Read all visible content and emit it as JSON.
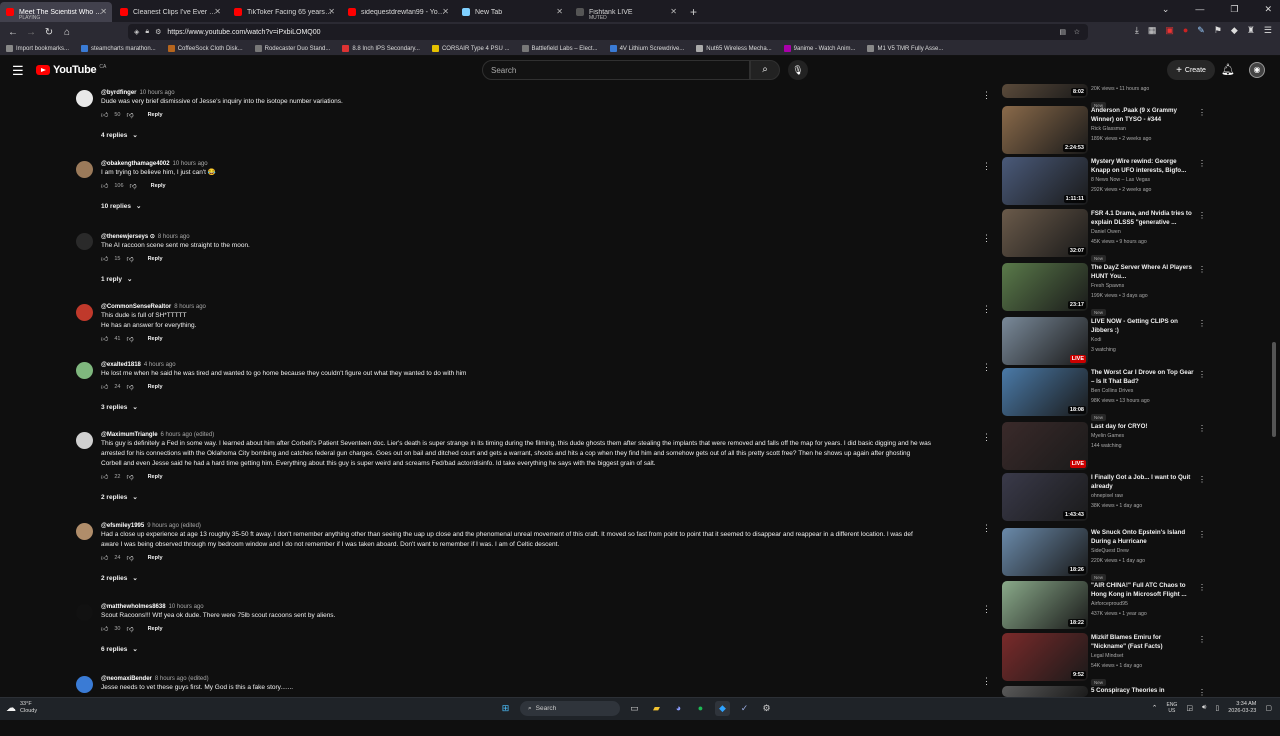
{
  "browser": {
    "tabs": [
      {
        "title": "Meet The Scientist Who Studie",
        "sub": "PLAYING",
        "active": true,
        "color": "#ff0000"
      },
      {
        "title": "Cleanest Clips I've Ever Hit - (I",
        "sub": "",
        "active": false,
        "color": "#ff0000"
      },
      {
        "title": "TikToker Facing 65 years in Pri",
        "sub": "",
        "active": false,
        "color": "#ff0000"
      },
      {
        "title": "sidequestdrewfan99 - YouTube",
        "sub": "",
        "active": false,
        "color": "#ff0000"
      },
      {
        "title": "New Tab",
        "sub": "",
        "active": false,
        "color": "#7fd0ff"
      },
      {
        "title": "Fishtank LIVE",
        "sub": "MUTED",
        "active": false,
        "color": "#555555"
      }
    ],
    "new_tab_symbol": "+",
    "url": "https://www.youtube.com/watch?v=iPxbiLOMQ00",
    "bookmarks": [
      "Import bookmarks...",
      "steamcharts marathon...",
      "CoffeeSock Cloth Disk...",
      "Rodecaster Duo Stand...",
      "8.8 Inch IPS Secondary...",
      "CORSAIR Type 4 PSU ...",
      "Battlefield Labs – Elect...",
      "4V Lithium Screwdrive...",
      "Nut65 Wireless Mecha...",
      "9anime - Watch Anim...",
      "M1 V5 TMR Fully Asse..."
    ]
  },
  "youtube": {
    "logo_text": "YouTube",
    "country": "CA",
    "search_placeholder": "Search",
    "create_label": "Create"
  },
  "comments": [
    {
      "author": "@byrdfinger",
      "time": "10 hours ago",
      "text": "Dude was very brief dismissive of Jesse's inquiry into the isotope number variations.",
      "likes": "50",
      "replies": "4 replies",
      "avatar_color": "#e8e8e8"
    },
    {
      "author": "@obakengthamage4002",
      "time": "10 hours ago",
      "text": "I am trying to believe him, I just can't 😂",
      "likes": "106",
      "replies": "10 replies",
      "avatar_color": "#9b7a5a"
    },
    {
      "author": "@thenewjerseys ⊙",
      "time": "8 hours ago",
      "text": "The AI raccoon scene sent me straight to the moon.",
      "likes": "15",
      "replies": "1 reply",
      "avatar_color": "#2a2a2a"
    },
    {
      "author": "@CommonSenseRealtor",
      "time": "8 hours ago",
      "text": "This dude is full of SH*TTTTT\nHe has an answer for everything.",
      "likes": "41",
      "replies": "",
      "avatar_color": "#c0392b"
    },
    {
      "author": "@exalted1818",
      "time": "4 hours ago",
      "text": "He lost me when he said he was tired and wanted to go home because they couldn't figure out what they wanted to do with him",
      "likes": "24",
      "replies": "3 replies",
      "avatar_color": "#7fb77e"
    },
    {
      "author": "@MaximumTriangle",
      "time": "6 hours ago (edited)",
      "text": "This guy is definitely a Fed in some way. I learned about him after Corbell's Patient Seventeen doc. Lier's death is super strange in its timing during the filming, this dude ghosts them after stealing the implants that were removed and falls off the map for years. I did basic digging and he was\narrested for his connections with the Oklahoma City bombing and catches federal gun charges. Goes out on bail and ditched court and gets a warrant, shoots and hits a cop when they find him and somehow gets out of all this pretty scott free? Then he shows up again after ghosting\nCorbell and even Jesse said he had a hard time getting him. Everything about this guy is super weird and screams Fed/bad actor/disinfo. Id take everything he says with the biggest grain of salt.",
      "likes": "22",
      "replies": "2 replies",
      "avatar_color": "#d0d0d0"
    },
    {
      "author": "@efsmiley1995",
      "time": "9 hours ago (edited)",
      "text": "Had a close up experience at age 13 roughly 35-50 ft  away. I don't remember anything other than seeing the uap up close and the phenomenal unreal movement of this craft. It moved so fast from point to point that it seemed to disappear and reappear in a different location. I was def\naware I was being observed through my bedroom window and I do not remember if I was taken aboard. Don't want to remember if I was. I am of Celtic descent.",
      "likes": "24",
      "replies": "2 replies",
      "avatar_color": "#b08d6a"
    },
    {
      "author": "@matthewholmes8638",
      "time": "10 hours ago",
      "text": "Scout Racoons!!! Wtf yea ok dude. There were 75lb scout racoons sent by aliens.",
      "likes": "30",
      "replies": "6 replies",
      "avatar_color": "#111111"
    },
    {
      "author": "@neomaxiBender",
      "time": "8 hours ago (edited)",
      "text": "Jesse needs to vet these guys first. My God is this a fake story.......",
      "likes": "",
      "replies": "",
      "avatar_color": "#3a7bd5"
    }
  ],
  "comment_reply_label": "Reply",
  "sidebar": [
    {
      "title": "",
      "channel": "",
      "meta": "20K views • 11 hours ago",
      "badge": "New",
      "duration": "8:02",
      "live": false,
      "thumb": "#5a4a3a"
    },
    {
      "title": "Anderson .Paak (9 x Grammy Winner) on TYSO - #344",
      "channel": "Rick Glassman",
      "meta": "189K views • 2 weeks ago",
      "badge": "",
      "duration": "2:24:53",
      "live": false,
      "thumb": "#8a6a4a"
    },
    {
      "title": "Mystery Wire rewind: George Knapp on UFO interests, Bigfo...",
      "channel": "8 News Now – Las Vegas",
      "meta": "292K views • 2 weeks ago",
      "badge": "",
      "duration": "1:11:11",
      "live": false,
      "thumb": "#4a5a7a"
    },
    {
      "title": "FSR 4.1 Drama, and Nvidia tries to explain DLSS5 \"generative ...",
      "channel": "Daniel Owen",
      "meta": "45K views • 9 hours ago",
      "badge": "New",
      "duration": "32:07",
      "live": false,
      "thumb": "#6a5a4a"
    },
    {
      "title": "The DayZ Server Where AI Players HUNT You...",
      "channel": "Fresh Spawns",
      "meta": "199K views • 3 days ago",
      "badge": "New",
      "duration": "23:17",
      "live": false,
      "thumb": "#5a7a4a"
    },
    {
      "title": "LIVE NOW - Getting CLIPS on Jibbers :)",
      "channel": "Kodi",
      "meta": "3 watching",
      "badge": "",
      "duration": "LIVE",
      "live": true,
      "thumb": "#7a8a9a"
    },
    {
      "title": "The Worst Car I Drove on Top Gear – Is It That Bad?",
      "channel": "Ben Collins Drives",
      "meta": "98K views • 13 hours ago",
      "badge": "New",
      "duration": "18:08",
      "live": false,
      "thumb": "#4a7aa8"
    },
    {
      "title": "Last day for CRYO!",
      "channel": "Myelin Games",
      "meta": "144 watching",
      "badge": "",
      "duration": "LIVE",
      "live": true,
      "thumb": "#3a2a2a"
    },
    {
      "title": "I Finally Got a Job... I want to Quit already",
      "channel": "ohnepixel raw",
      "meta": "38K views • 1 day ago",
      "badge": "",
      "duration": "1:43:43",
      "live": false,
      "thumb": "#3a3a4a"
    },
    {
      "title": "We Snuck Onto Epstein's Island During a Hurricane",
      "channel": "SideQuest Drew",
      "meta": "220K views • 1 day ago",
      "badge": "New",
      "duration": "18:26",
      "live": false,
      "thumb": "#6a8aaa"
    },
    {
      "title": "\"AIR CHINA!\" Full ATC Chaos to Hong Kong in Microsoft Flight ...",
      "channel": "Airforceproud95",
      "meta": "437K views • 1 year ago",
      "badge": "",
      "duration": "18:22",
      "live": false,
      "thumb": "#8aaa8a"
    },
    {
      "title": "Mizkif Blames Emiru for \"Nickname\" (Fast Facts)",
      "channel": "Legal Mindset",
      "meta": "54K views • 1 day ago",
      "badge": "New",
      "duration": "9:52",
      "live": false,
      "thumb": "#7a2a2a"
    },
    {
      "title": "5 Conspiracy Theories in",
      "channel": "",
      "meta": "",
      "badge": "",
      "duration": "",
      "live": false,
      "thumb": "#5a5a5a"
    }
  ],
  "taskbar": {
    "weather_temp": "33°F",
    "weather_desc": "Cloudy",
    "search_label": "Search",
    "lang": "ENG",
    "region": "US",
    "time": "3:34 AM",
    "date": "2026-03-23"
  }
}
